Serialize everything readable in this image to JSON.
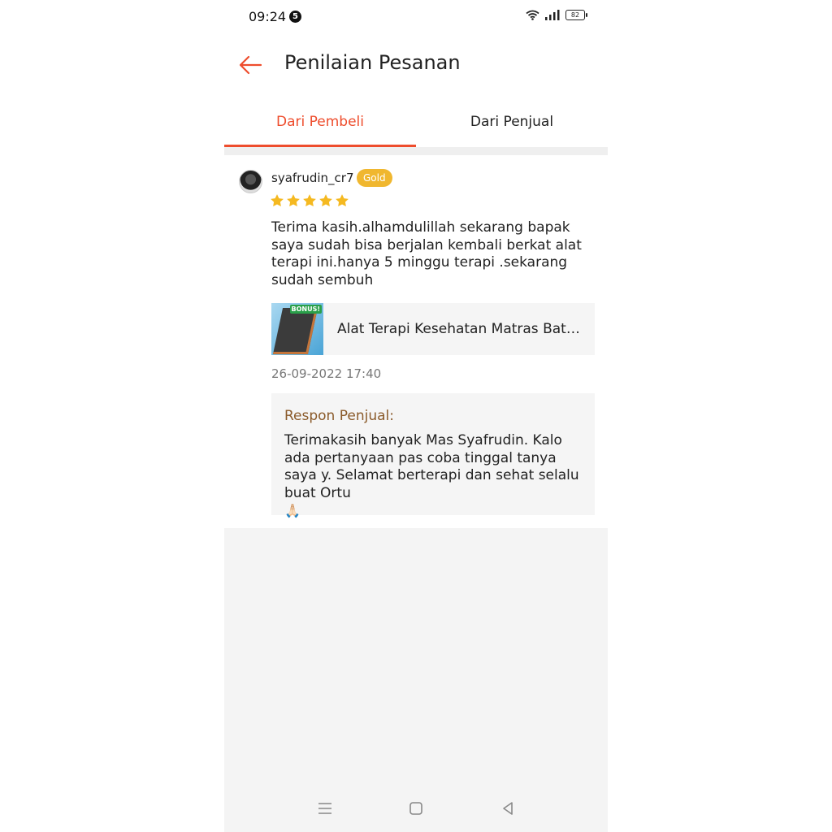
{
  "status_bar": {
    "time": "09:24",
    "notification_count": "5",
    "battery": "82"
  },
  "header": {
    "title": "Penilaian Pesanan"
  },
  "tabs": [
    {
      "label": "Dari Pembeli",
      "active": true
    },
    {
      "label": "Dari Penjual",
      "active": false
    }
  ],
  "review": {
    "username": "syafrudin_cr7",
    "badge": "Gold",
    "rating": 5,
    "text": "Terima kasih.alhamdulillah sekarang bapak saya sudah bisa berjalan kembali berkat alat terapi ini.hanya 5 minggu terapi .sekarang sudah sembuh",
    "product": {
      "name": "Alat Terapi Kesehatan Matras Batu Giok Jade Tourmaline",
      "thumb_text": "BONUS!"
    },
    "date": "26-09-2022 17:40",
    "seller_response": {
      "label": "Respon Penjual:",
      "text": "Terimakasih banyak Mas Syafrudin. Kalo ada pertanyaan pas coba tinggal tanya saya y. Selamat berterapi dan sehat selalu buat Ortu",
      "emoji": "🙏🏻"
    }
  },
  "colors": {
    "accent": "#ee4d2d",
    "gold": "#f0b72f",
    "star": "#f5b921",
    "seller_label": "#8a5a2a"
  },
  "icons": {
    "back": "arrow-left-icon",
    "wifi": "wifi-icon",
    "signal": "signal-icon",
    "battery": "battery-icon",
    "nav_menu": "menu-icon",
    "nav_home": "square-home-icon",
    "nav_back": "triangle-back-icon"
  }
}
